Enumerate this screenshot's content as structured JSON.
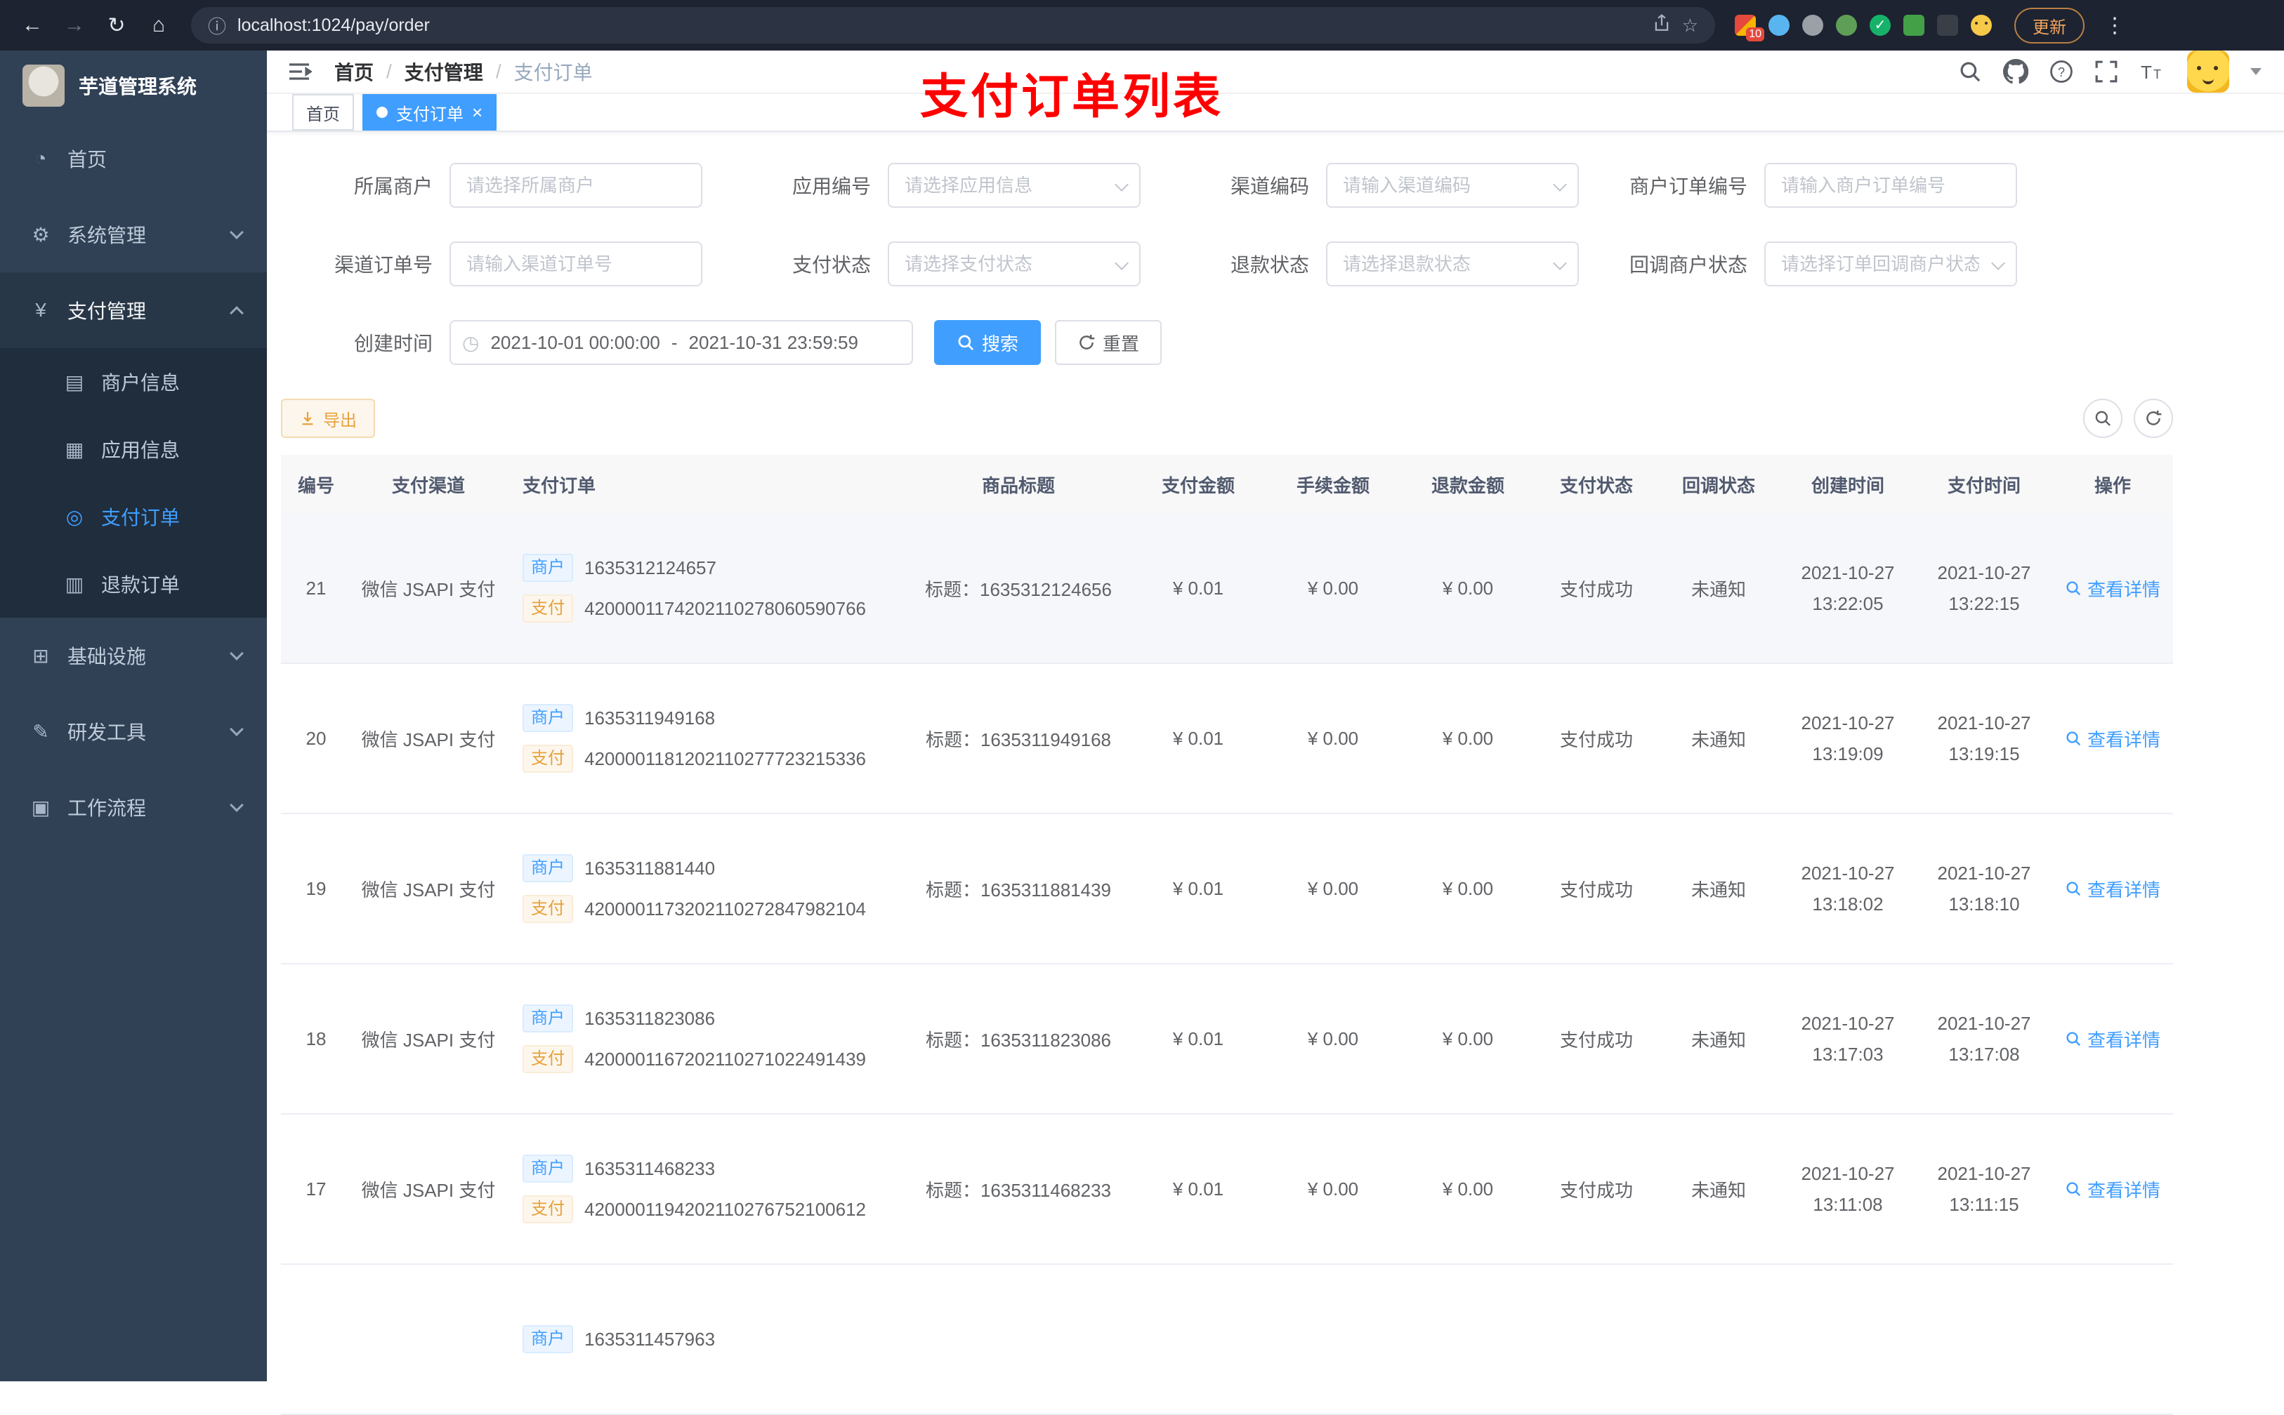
{
  "icons": {
    "back": "←",
    "forward": "→",
    "reload": "↻",
    "home": "⌂",
    "info": "ⓘ",
    "star": "☆",
    "menu_dots": "⋮",
    "dashboard": "◔",
    "gear": "⚙",
    "yen": "¥",
    "card": "▤",
    "grid": "▦",
    "target": "◎",
    "doc": "▥",
    "monitor": "⊞",
    "tool": "✎",
    "case": "▣",
    "clock": "◷",
    "close": "×",
    "check": "✓"
  },
  "browser": {
    "url": "localhost:1024/pay/order",
    "update_label": "更新",
    "ext_badge": "10"
  },
  "sidebar": {
    "title": "芋道管理系统",
    "home": "首页",
    "system": "系统管理",
    "pay": "支付管理",
    "sub_merchant": "商户信息",
    "sub_app": "应用信息",
    "sub_order": "支付订单",
    "sub_refund": "退款订单",
    "infra": "基础设施",
    "dev": "研发工具",
    "flow": "工作流程"
  },
  "navbar": {
    "breadcrumb": {
      "home": "首页",
      "section": "支付管理",
      "current": "支付订单",
      "sep": "/"
    },
    "annotation": "支付订单列表"
  },
  "tags": {
    "home": "首页",
    "current": "支付订单"
  },
  "filters": {
    "merchant": {
      "label": "所属商户",
      "placeholder": "请选择所属商户"
    },
    "app": {
      "label": "应用编号",
      "placeholder": "请选择应用信息"
    },
    "channel_code": {
      "label": "渠道编码",
      "placeholder": "请输入渠道编码"
    },
    "merchant_order": {
      "label": "商户订单编号",
      "placeholder": "请输入商户订单编号"
    },
    "channel_order": {
      "label": "渠道订单号",
      "placeholder": "请输入渠道订单号"
    },
    "pay_status": {
      "label": "支付状态",
      "placeholder": "请选择支付状态"
    },
    "refund_status": {
      "label": "退款状态",
      "placeholder": "请选择退款状态"
    },
    "notify_status": {
      "label": "回调商户状态",
      "placeholder": "请选择订单回调商户状态"
    },
    "create_time": {
      "label": "创建时间",
      "start": "2021-10-01 00:00:00",
      "sep": "-",
      "end": "2021-10-31 23:59:59"
    },
    "search_label": "搜索",
    "reset_label": "重置"
  },
  "toolbar": {
    "export_label": "导出"
  },
  "table": {
    "columns": [
      "编号",
      "支付渠道",
      "支付订单",
      "商品标题",
      "支付金额",
      "手续金额",
      "退款金额",
      "支付状态",
      "回调状态",
      "创建时间",
      "支付时间",
      "操作"
    ],
    "rows": [
      {
        "no": "21",
        "channel": "微信 JSAPI 支付",
        "merchant_tag": "商户",
        "merchant_no": "1635312124657",
        "pay_tag": "支付",
        "pay_no": "4200001174202110278060590766",
        "title": "标题：1635312124656",
        "amount": "¥ 0.01",
        "fee": "¥ 0.00",
        "refund": "¥ 0.00",
        "status": "支付成功",
        "notify": "未通知",
        "created_date": "2021-10-27",
        "created_time": "13:22:05",
        "paid_date": "2021-10-27",
        "paid_time": "13:22:15",
        "action": "查看详情"
      },
      {
        "no": "20",
        "channel": "微信 JSAPI 支付",
        "merchant_tag": "商户",
        "merchant_no": "1635311949168",
        "pay_tag": "支付",
        "pay_no": "4200001181202110277723215336",
        "title": "标题：1635311949168",
        "amount": "¥ 0.01",
        "fee": "¥ 0.00",
        "refund": "¥ 0.00",
        "status": "支付成功",
        "notify": "未通知",
        "created_date": "2021-10-27",
        "created_time": "13:19:09",
        "paid_date": "2021-10-27",
        "paid_time": "13:19:15",
        "action": "查看详情"
      },
      {
        "no": "19",
        "channel": "微信 JSAPI 支付",
        "merchant_tag": "商户",
        "merchant_no": "1635311881440",
        "pay_tag": "支付",
        "pay_no": "4200001173202110272847982104",
        "title": "标题：1635311881439",
        "amount": "¥ 0.01",
        "fee": "¥ 0.00",
        "refund": "¥ 0.00",
        "status": "支付成功",
        "notify": "未通知",
        "created_date": "2021-10-27",
        "created_time": "13:18:02",
        "paid_date": "2021-10-27",
        "paid_time": "13:18:10",
        "action": "查看详情"
      },
      {
        "no": "18",
        "channel": "微信 JSAPI 支付",
        "merchant_tag": "商户",
        "merchant_no": "1635311823086",
        "pay_tag": "支付",
        "pay_no": "4200001167202110271022491439",
        "title": "标题：1635311823086",
        "amount": "¥ 0.01",
        "fee": "¥ 0.00",
        "refund": "¥ 0.00",
        "status": "支付成功",
        "notify": "未通知",
        "created_date": "2021-10-27",
        "created_time": "13:17:03",
        "paid_date": "2021-10-27",
        "paid_time": "13:17:08",
        "action": "查看详情"
      },
      {
        "no": "17",
        "channel": "微信 JSAPI 支付",
        "merchant_tag": "商户",
        "merchant_no": "1635311468233",
        "pay_tag": "支付",
        "pay_no": "4200001194202110276752100612",
        "title": "标题：1635311468233",
        "amount": "¥ 0.01",
        "fee": "¥ 0.00",
        "refund": "¥ 0.00",
        "status": "支付成功",
        "notify": "未通知",
        "created_date": "2021-10-27",
        "created_time": "13:11:08",
        "paid_date": "2021-10-27",
        "paid_time": "13:11:15",
        "action": "查看详情"
      },
      {
        "no": "",
        "channel": "",
        "merchant_tag": "商户",
        "merchant_no": "1635311457963"
      }
    ]
  }
}
